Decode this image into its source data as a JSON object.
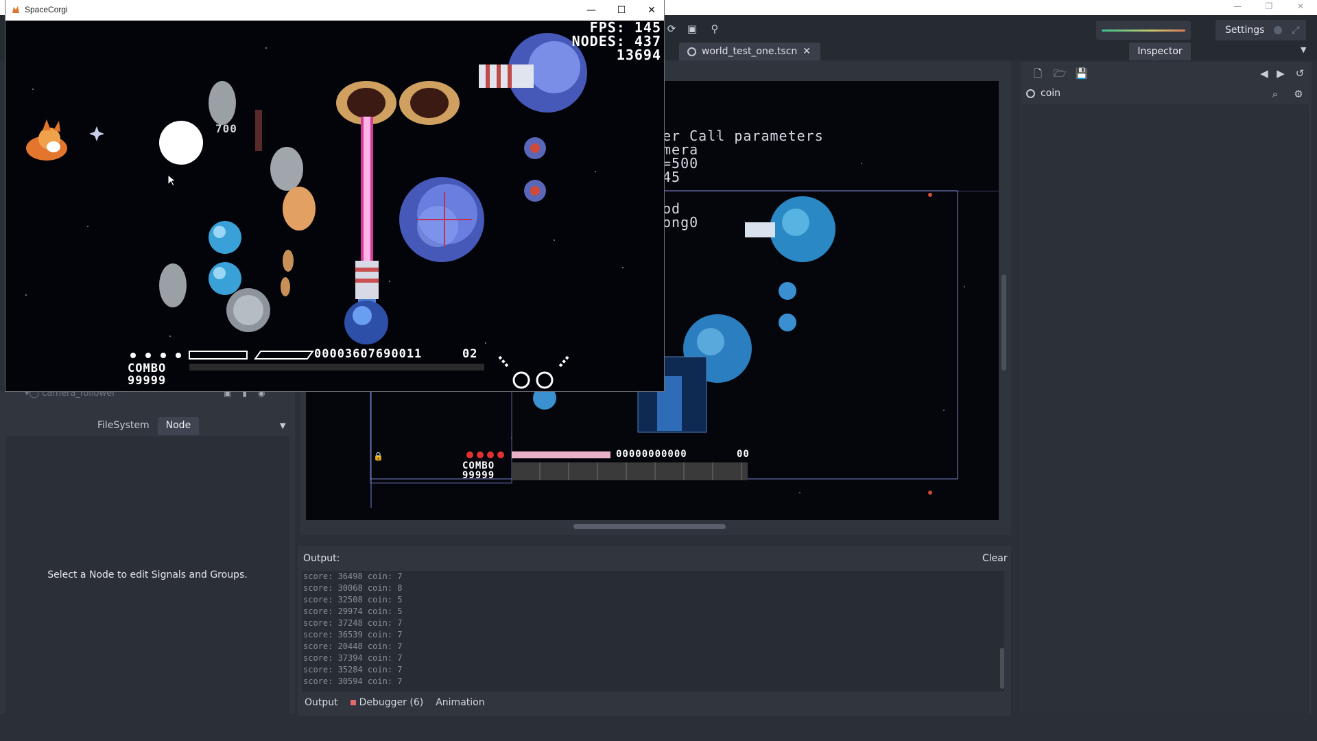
{
  "game_window": {
    "title": "SpaceCorgi",
    "hud": {
      "fps_label": "FPS:",
      "fps_value": "145",
      "nodes_label": "NODES:",
      "nodes_value": "437",
      "objects_value": "13694",
      "combo_label": "COMBO",
      "combo_value": "99999",
      "score_digits": "00003607690011",
      "bonus_label": "02",
      "floating_score": "700"
    }
  },
  "editor": {
    "scene_tab": "world_test_one.tscn",
    "settings_label": "Settings",
    "inspector_tab": "Inspector",
    "inspector_node": "coin",
    "viewport_text": {
      "line1": "er Call parameters",
      "line2": "mera",
      "line3": "=500",
      "line4": "45",
      "line5": "od",
      "line6": "ong0"
    },
    "viewport_hud": {
      "combo_label": "COMBO",
      "combo_value": "99999",
      "score_digits": "00000000000",
      "bonus_label": "00"
    },
    "left_dock": {
      "camera_node": "camera_follower",
      "tabs": [
        "FileSystem",
        "Node"
      ],
      "message": "Select a Node to edit Signals and Groups."
    },
    "output": {
      "title": "Output:",
      "clear_label": "Clear",
      "lines": [
        "score: 36498 coin: 7",
        "score: 30068 coin: 8",
        "score: 32508 coin: 5",
        "score: 29974 coin: 5",
        "score: 37248 coin: 7",
        "score: 36539 coin: 7",
        "score: 20448 coin: 7",
        "score: 37394 coin: 7",
        "score: 35284 coin: 7",
        "score: 30594 coin: 7"
      ],
      "tabs": {
        "output": "Output",
        "debugger": "Debugger (6)",
        "animation": "Animation"
      }
    }
  },
  "colors": {
    "editor_bg": "#2b2f38",
    "panel": "#30353e",
    "accent_debug": "#e26a6a",
    "space": "#03040a"
  }
}
